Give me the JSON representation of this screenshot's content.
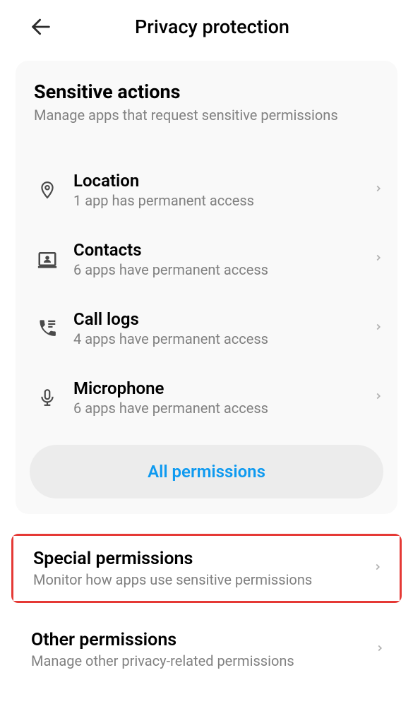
{
  "header": {
    "title": "Privacy protection"
  },
  "card": {
    "title": "Sensitive actions",
    "subtitle": "Manage apps that request sensitive permissions",
    "items": [
      {
        "title": "Location",
        "subtitle": "1 app has permanent access"
      },
      {
        "title": "Contacts",
        "subtitle": "6 apps have permanent access"
      },
      {
        "title": "Call logs",
        "subtitle": "4 apps have permanent access"
      },
      {
        "title": "Microphone",
        "subtitle": "6 apps have permanent access"
      }
    ],
    "button": "All permissions"
  },
  "sections": [
    {
      "title": "Special permissions",
      "subtitle": "Monitor how apps use sensitive permissions"
    },
    {
      "title": "Other permissions",
      "subtitle": "Manage other privacy-related permissions"
    }
  ]
}
